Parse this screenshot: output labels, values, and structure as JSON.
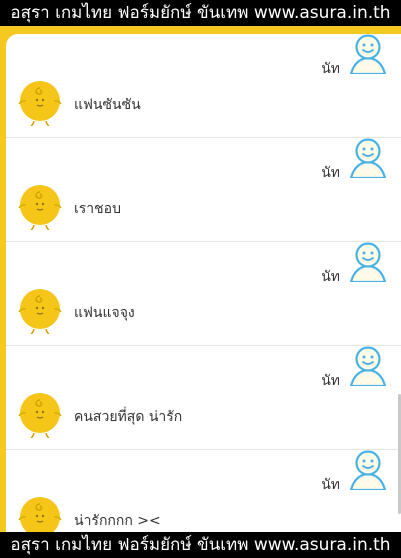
{
  "watermark": {
    "top_text": "อสุรา เกมไทย ฟอร์มยักษ์ ขันเทพ www.asura.in.th",
    "bottom_text": "อสุรา เกมไทย ฟอร์มยักษ์ ขันเทพ www.asura.in.th"
  },
  "colors": {
    "frame": "#f6c91f",
    "user_avatar_outline": "#4ab3e6",
    "user_avatar_fill": "#fffbe6",
    "bot_avatar": "#f5c518"
  },
  "conversations": [
    {
      "user_name": "นัท",
      "reply": "แฟนซันซัน"
    },
    {
      "user_name": "นัท",
      "reply": "เราชอบ"
    },
    {
      "user_name": "นัท",
      "reply": "แฟนแจจุง"
    },
    {
      "user_name": "นัท",
      "reply": "คนสวยที่สุด น่ารัก"
    },
    {
      "user_name": "นัท",
      "reply": "น่ารักกกก ><"
    }
  ]
}
